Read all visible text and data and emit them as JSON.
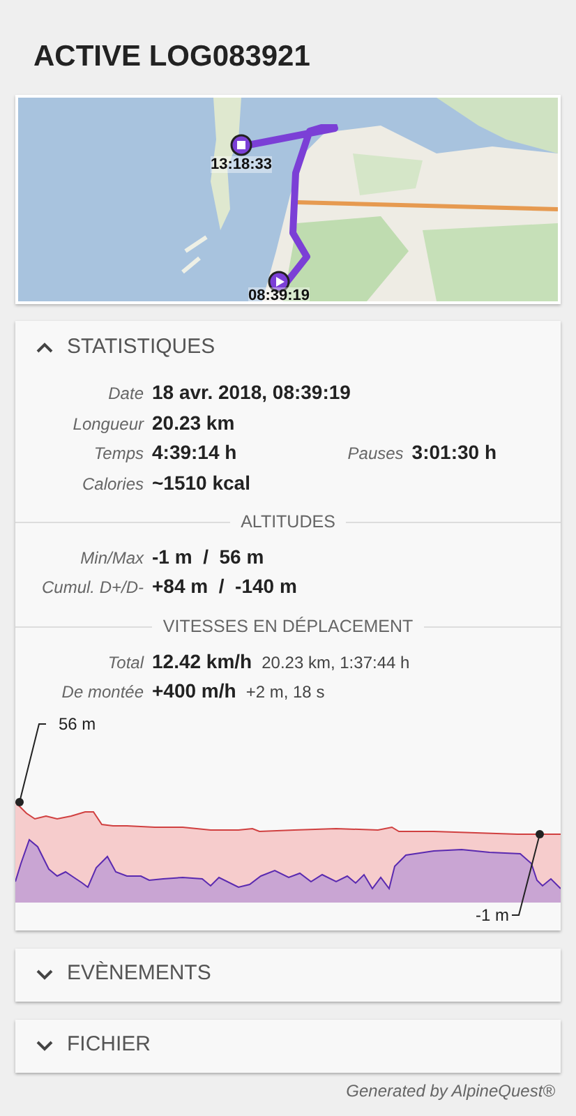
{
  "title": "ACTIVE LOG083921",
  "map": {
    "stop_time": "13:18:33",
    "start_time": "08:39:19"
  },
  "sections": [
    {
      "title": "STATISTIQUES",
      "expanded": true,
      "groups": [
        {
          "rows": [
            [
              {
                "label": "Date",
                "value": "18 avr. 2018, 08:39:19"
              }
            ],
            [
              {
                "label": "Longueur",
                "value": "20.23 km"
              }
            ],
            [
              {
                "label": "Temps",
                "value": "4:39:14 h"
              },
              {
                "label": "Pauses",
                "value": "3:01:30 h"
              }
            ],
            [
              {
                "label": "Calories",
                "value": "~1510 kcal"
              }
            ]
          ]
        },
        {
          "heading": "ALTITUDES",
          "rows": [
            [
              {
                "label": "Min/Max",
                "value": "-1 m  /  56 m"
              }
            ],
            [
              {
                "label": "Cumul. D+/D-",
                "value": "+84 m  /  -140 m"
              }
            ]
          ]
        },
        {
          "heading": "VITESSES EN DÉPLACEMENT",
          "rows": [
            [
              {
                "label": "Total",
                "value": "12.42 km/h",
                "note": "20.23 km, 1:37:44 h"
              }
            ],
            [
              {
                "label": "De montée",
                "value": "+400 m/h",
                "note": "+2 m, 18 s"
              }
            ]
          ]
        }
      ],
      "profile": {
        "max_label": "56 m",
        "min_label": "-1 m"
      }
    },
    {
      "title": "EVÈNEMENTS",
      "expanded": false
    },
    {
      "title": "FICHIER",
      "expanded": false
    }
  ],
  "footer": "Generated by AlpineQuest®"
}
